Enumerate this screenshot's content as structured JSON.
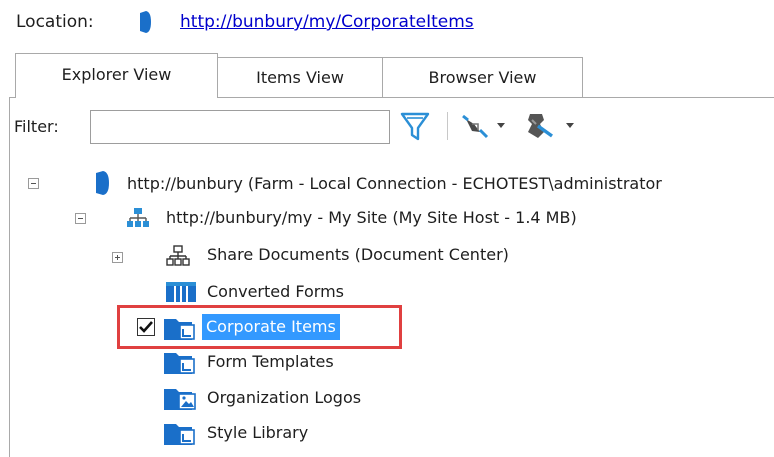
{
  "location": {
    "label": "Location:",
    "url": "http://bunbury/my/CorporateItems"
  },
  "tabs": [
    {
      "label": "Explorer View",
      "active": true
    },
    {
      "label": "Items View",
      "active": false
    },
    {
      "label": "Browser View",
      "active": false
    }
  ],
  "filter": {
    "label": "Filter:",
    "value": "",
    "placeholder": ""
  },
  "toolbar": {
    "icons": [
      "filter-funnel-icon",
      "connect-dropdown-icon",
      "disconnect-dropdown-icon"
    ]
  },
  "tree": {
    "farm": {
      "label": "http://bunbury (Farm - Local Connection - ECHOTEST\\administrator",
      "expanded": true,
      "icon": "sharepoint-farm-icon"
    },
    "site": {
      "label": "http://bunbury/my - My Site (My Site Host - 1.4 MB)",
      "expanded": true,
      "icon": "site-icon"
    },
    "items": [
      {
        "label": "Share Documents (Document Center)",
        "icon": "subsite-icon",
        "expandable": true
      },
      {
        "label": "Converted Forms",
        "icon": "list-icon"
      },
      {
        "label": "Corporate Items",
        "icon": "document-library-icon",
        "checked": true,
        "selected": true
      },
      {
        "label": "Form Templates",
        "icon": "document-library-icon"
      },
      {
        "label": "Organization Logos",
        "icon": "picture-library-icon"
      },
      {
        "label": "Style Library",
        "icon": "document-library-icon"
      }
    ]
  },
  "colors": {
    "selection": "#3399ff",
    "highlight_box": "#e04040",
    "link": "#0000cc",
    "icon_blue": "#1a6fc9"
  }
}
